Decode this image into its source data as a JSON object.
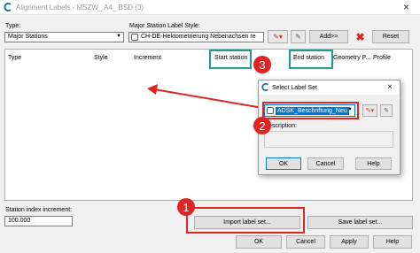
{
  "window": {
    "title": "Alignment Labels - MSZW_ A4_ BSD (3)",
    "close_glyph": "×"
  },
  "top_panel": {
    "type_label": "Type:",
    "type_value": "Major Stations",
    "style_label": "Major Station Label Style:",
    "style_value": "CH-DE-Hektometrierung Nebenachsen re",
    "add_label": "Add>>",
    "reset_label": "Reset"
  },
  "grid": {
    "columns": [
      "Type",
      "Style",
      "Increment",
      "Start station",
      "End station",
      "Geometry P...",
      "Profile"
    ]
  },
  "bottom_panel": {
    "increment_label": "Station index increment:",
    "increment_value": "100.000",
    "import_label": "Import label set...",
    "save_label": "Save label set...",
    "ok_label": "OK",
    "cancel_label": "Cancel",
    "apply_label": "Apply",
    "help_label": "Help"
  },
  "select_dialog": {
    "title": "Select Label Set",
    "close_glyph": "×",
    "value": "ADSK_Beschriftung_Neu",
    "description_label": "Description:",
    "ok_label": "OK",
    "cancel_label": "Cancel",
    "help_label": "Help"
  },
  "callouts": [
    "1",
    "2",
    "3"
  ],
  "colors": {
    "callout_red": "#e02424",
    "highlight_green": "#1f9d8a",
    "selection_blue": "#0078d7"
  }
}
